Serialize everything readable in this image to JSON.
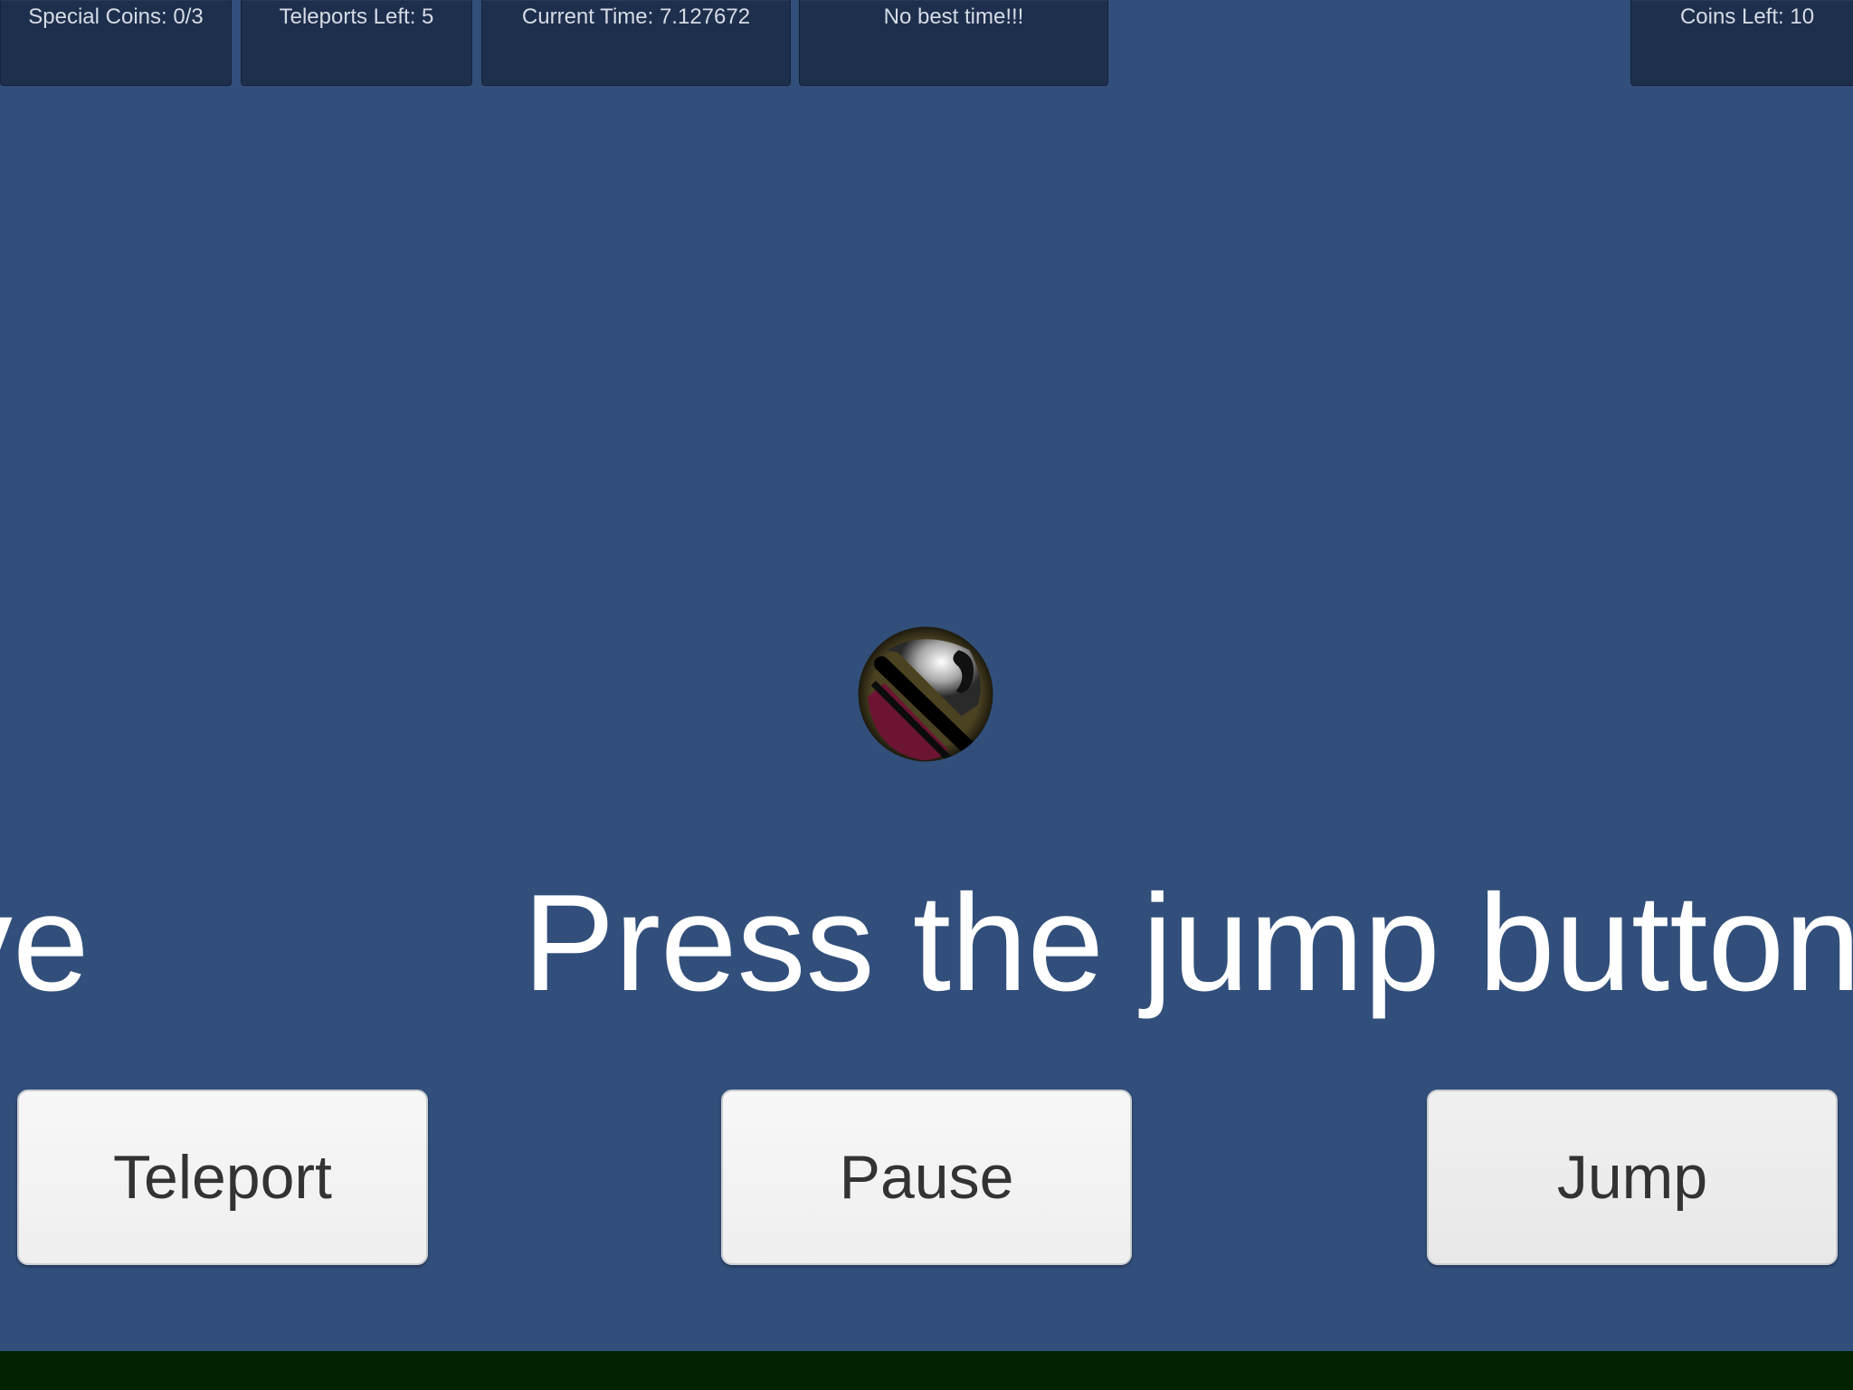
{
  "hud": {
    "special_coins": "Special Coins: 0/3",
    "teleports_left": "Teleports Left: 5",
    "current_time": "Current Time: 7.127672",
    "best_time": "No best time!!!",
    "coins_left": "Coins Left: 10"
  },
  "hints": {
    "left_fragment": "ve",
    "main": "Press the jump button"
  },
  "buttons": {
    "teleport": "Teleport",
    "pause": "Pause",
    "jump": "Jump"
  },
  "colors": {
    "background": "#324f7b",
    "hud_box": "#1e2f4e",
    "ground": "#002200",
    "button": "#f4f4f4"
  }
}
